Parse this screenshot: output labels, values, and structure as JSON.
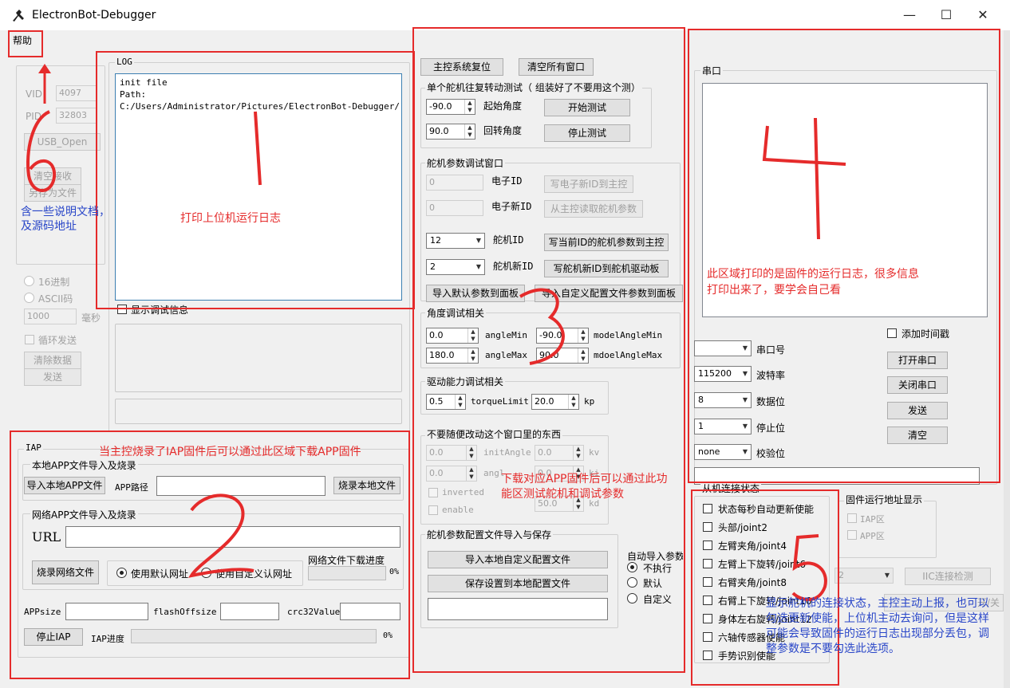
{
  "window": {
    "title": "ElectronBot-Debugger",
    "minimize": "—",
    "maximize": "☐",
    "close": "✕"
  },
  "menu": {
    "help": "帮助"
  },
  "left_panel": {
    "vid_label": "VID",
    "vid_value": "4097",
    "pid_label": "PID",
    "pid_value": "32803",
    "usb_open": "USB_Open",
    "clear_recv": "清空接收",
    "save_as": "另存为文件",
    "hex16": "16进制",
    "ascii": "ASCII码",
    "interval_value": "1000",
    "ms": "毫秒",
    "loop_send": "循环发送",
    "clear_data": "清除数据",
    "send": "发送"
  },
  "log": {
    "title": "LOG",
    "lines": [
      "init file",
      "Path:",
      "C:/Users/Administrator/Pictures/ElectronBot-Debugger/"
    ],
    "show_debug": "显示调试信息"
  },
  "iap": {
    "title": "IAP",
    "local_group": "本地APP文件导入及烧录",
    "import_local": "导入本地APP文件",
    "app_path_label": "APP路径",
    "burn_local": "烧录本地文件",
    "net_group": "网络APP文件导入及烧录",
    "url_label": "URL",
    "burn_net": "烧录网络文件",
    "use_default": "使用默认网址",
    "use_custom": "使用自定义认网址",
    "net_progress_label": "网络文件下载进度",
    "net_progress": "0%",
    "appsize": "APPsize",
    "flashoffsize": "flashOffsize",
    "crc32": "crc32Value",
    "stop_iap": "停止IAP",
    "iap_progress_label": "IAP进度",
    "iap_progress": "0%"
  },
  "servo": {
    "reset": "主控系统复位",
    "clear_windows": "清空所有窗口",
    "single_test_title": "单个舵机往复转动测试（ 组装好了不要用这个测）",
    "start_angle_value": "-90.0",
    "start_angle_label": "起始角度",
    "start_test": "开始测试",
    "return_angle_value": "90.0",
    "return_angle_label": "回转角度",
    "stop_test": "停止测试",
    "param_title": "舵机参数调试窗口",
    "electron_id_value": "0",
    "electron_id_label": "电子ID",
    "write_new_id": "写电子新ID到主控",
    "electron_new_id_value": "0",
    "electron_new_id_label": "电子新ID",
    "read_params": "从主控读取舵机参数",
    "servo_id_value": "12",
    "servo_id_label": "舵机ID",
    "write_params": "写当前ID的舵机参数到主控",
    "servo_new_id_value": "2",
    "servo_new_id_label": "舵机新ID",
    "write_new_id_board": "写舵机新ID到舵机驱动板",
    "import_default": "导入默认参数到面板",
    "import_custom": "导入自定义配置文件参数到面板",
    "angle_title": "角度调试相关",
    "angle_min_value": "0.0",
    "angle_min_label": "angleMin",
    "model_min_value": "-90.0",
    "model_min_label": "modelAngleMin",
    "angle_max_value": "180.0",
    "angle_max_label": "angleMax",
    "model_max_value": "90.0",
    "model_max_label": "mdoelAngleMax",
    "drive_title": "驱动能力调试相关",
    "torque_value": "0.5",
    "torque_label": "torqueLimit",
    "kp_value": "20.0",
    "kp_label": "kp",
    "nochange_title": "不要随便改动这个窗口里的东西",
    "init_angle_value": "0.0",
    "init_angle_label": "initAngle",
    "kv_value": "0.0",
    "kv_label": "kv",
    "angle2_value": "0.0",
    "angle2_label": "angl",
    "ki_value": "0.0",
    "ki_label": "ki",
    "inverted": "inverted",
    "kd_value": "50.0",
    "kd_label": "kd",
    "enable": "enable",
    "config_title": "舵机参数配置文件导入与保存",
    "import_local_config": "导入本地自定义配置文件",
    "save_local_config": "保存设置到本地配置文件",
    "auto_import_title": "自动导入参数",
    "no_exec": "不执行",
    "default": "默认",
    "custom": "自定义"
  },
  "serial": {
    "title": "串口",
    "add_timestamp": "添加时间戳",
    "port_label": "串口号",
    "baud_value": "115200",
    "baud_label": "波特率",
    "data_bits_value": "8",
    "data_bits_label": "数据位",
    "stop_bits_value": "1",
    "stop_bits_label": "停止位",
    "parity_value": "none",
    "parity_label": "校验位",
    "open": "打开串口",
    "close": "关闭串口",
    "send": "发送",
    "clear": "清空"
  },
  "slave": {
    "title": "从机连接状态",
    "items": [
      "状态每秒自动更新使能",
      "头部/joint2",
      "左臂夹角/joint4",
      "左臂上下旋转/joint6",
      "右臂夹角/joint8",
      "右臂上下旋转/joint10",
      "身体左右旋转/joint12",
      "六轴传感器使能",
      "手势识别使能"
    ]
  },
  "firmware": {
    "title": "固件运行地址显示",
    "iap": "IAP区",
    "app": "APP区",
    "combo_value": "2",
    "iic_check": "IIC连接检测",
    "toggle": "开/关"
  },
  "annotations": {
    "n1": "1",
    "n2": "2",
    "n3": "3",
    "n4": "4",
    "n5": "5",
    "n6": "6",
    "a6": "含一些说明文档，及源码地址",
    "a1": "打印上位机运行日志",
    "a2": "当主控烧录了IAP固件后可以通过此区域下载APP固件",
    "a3": "下载对应APP固件后可以通过此功能区测试舵机和调试参数",
    "a4": "此区域打印的是固件的运行日志，很多信息打印出来了，要学会自己看",
    "a5": "显示舵机的连接状态，主控主动上报，也可以勾选更新使能，上位机主动去询问，但是这样可能会导致固件的运行日志出现部分丢包，调整参数是不要勾选此选项。"
  },
  "colors": {
    "annotation_red": "#e52b2b",
    "annotation_blue": "#2946c8"
  }
}
